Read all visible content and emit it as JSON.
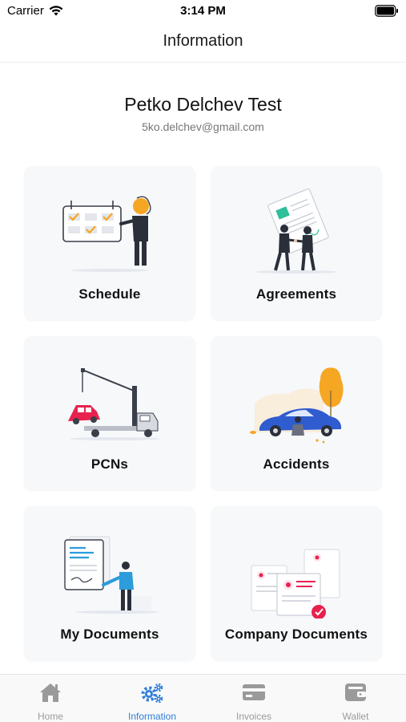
{
  "status_bar": {
    "carrier": "Carrier",
    "time": "3:14 PM"
  },
  "nav": {
    "title": "Information"
  },
  "profile": {
    "name": "Petko Delchev Test",
    "email": "5ko.delchev@gmail.com"
  },
  "cards": [
    {
      "label": "Schedule",
      "icon": "calendar-illustration"
    },
    {
      "label": "Agreements",
      "icon": "handshake-illustration"
    },
    {
      "label": "PCNs",
      "icon": "tow-truck-illustration"
    },
    {
      "label": "Accidents",
      "icon": "car-accident-illustration"
    },
    {
      "label": "My Documents",
      "icon": "document-signing-illustration"
    },
    {
      "label": "Company Documents",
      "icon": "company-documents-illustration"
    }
  ],
  "tabs": [
    {
      "label": "Home",
      "icon": "home-icon",
      "active": false
    },
    {
      "label": "Information",
      "icon": "gears-icon",
      "active": true
    },
    {
      "label": "Invoices",
      "icon": "card-icon",
      "active": false
    },
    {
      "label": "Wallet",
      "icon": "wallet-icon",
      "active": false
    }
  ],
  "colors": {
    "accent": "#2f7ed8",
    "inactive": "#9a9a9a",
    "card_bg": "#f6f8fa",
    "orange": "#f5a623",
    "red": "#e8214f"
  }
}
